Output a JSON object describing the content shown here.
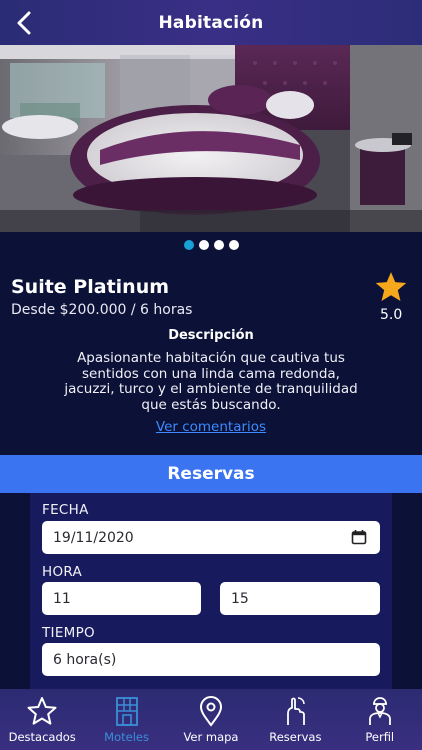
{
  "header": {
    "title": "Habitación",
    "back_icon": "chevron-left-icon"
  },
  "gallery": {
    "page_count": 4,
    "active_index": 0
  },
  "room": {
    "name": "Suite Platinum",
    "price": "Desde $200.000 / 6 horas",
    "rating": "5.0",
    "rating_icon": "star-icon"
  },
  "description": {
    "title": "Descripción",
    "text": "Apasionante habitación que cautiva tus sentidos con una linda cama redonda, jacuzzi, turco y el ambiente de tranquilidad que estás buscando.",
    "comments_link": "Ver comentarios"
  },
  "reservas": {
    "title": "Reservas",
    "fecha_label": "FECHA",
    "fecha_value": "19/11/2020",
    "hora_label": "HORA",
    "hora_start": "11",
    "hora_end": "15",
    "tiempo_label": "TIEMPO",
    "tiempo_value": "6 hora(s)"
  },
  "tabs": [
    {
      "label": "Destacados",
      "icon": "star-outline-icon",
      "active": false
    },
    {
      "label": "Moteles",
      "icon": "building-icon",
      "active": true
    },
    {
      "label": "Ver mapa",
      "icon": "map-pin-icon",
      "active": false
    },
    {
      "label": "Reservas",
      "icon": "reservation-hand-icon",
      "active": false
    },
    {
      "label": "Perfil",
      "icon": "person-icon",
      "active": false
    }
  ],
  "colors": {
    "background": "#0c1138",
    "header": "#2f2d7c",
    "accent_blue": "#3b74f1",
    "link": "#3d8bff",
    "active_tab": "#3a8fd8",
    "star": "#f6a81c"
  }
}
